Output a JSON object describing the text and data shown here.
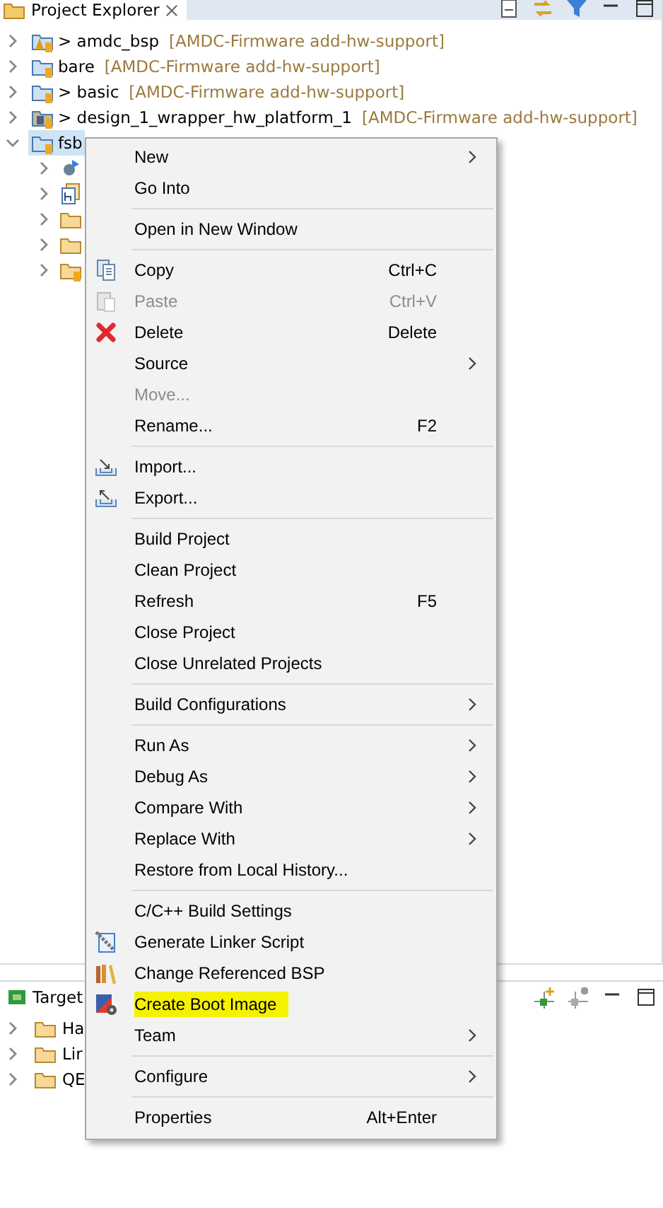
{
  "explorer": {
    "title": "Project Explorer",
    "items": [
      {
        "name": "> amdc_bsp",
        "decoration": "[AMDC-Firmware add-hw-support]",
        "kind": "bsp",
        "expanded": false,
        "selected": false
      },
      {
        "name": "bare",
        "decoration": "[AMDC-Firmware add-hw-support]",
        "kind": "project",
        "expanded": false,
        "selected": false
      },
      {
        "name": "> basic",
        "decoration": "[AMDC-Firmware add-hw-support]",
        "kind": "project",
        "expanded": false,
        "selected": false
      },
      {
        "name": "> design_1_wrapper_hw_platform_1",
        "decoration": "[AMDC-Firmware add-hw-support]",
        "kind": "hw",
        "expanded": false,
        "selected": false
      },
      {
        "name": "fsb",
        "kind": "project",
        "expanded": true,
        "selected": true,
        "children": [
          {
            "kind": "binaries",
            "expanded": false
          },
          {
            "kind": "includes",
            "expanded": false
          },
          {
            "kind": "folder",
            "expanded": false
          },
          {
            "kind": "folder",
            "expanded": false
          },
          {
            "kind": "lockfolder",
            "expanded": false
          }
        ]
      }
    ]
  },
  "target_panel": {
    "title": "Target",
    "items": [
      {
        "name": "Ha",
        "expanded": false
      },
      {
        "name": "Lir",
        "expanded": false
      },
      {
        "name": "QE",
        "expanded": false
      }
    ]
  },
  "context_menu": {
    "groups": [
      [
        {
          "label": "New",
          "submenu": true,
          "disabled": false,
          "highlighted": false
        },
        {
          "label": "Go Into",
          "submenu": false,
          "disabled": false,
          "highlighted": false
        }
      ],
      [
        {
          "label": "Open in New Window",
          "submenu": false,
          "disabled": false,
          "highlighted": false
        }
      ],
      [
        {
          "label": "Copy",
          "kind": "copy",
          "shortcut": "Ctrl+C",
          "submenu": false,
          "disabled": false,
          "highlighted": false
        },
        {
          "label": "Paste",
          "kind": "paste",
          "shortcut": "Ctrl+V",
          "submenu": false,
          "disabled": true,
          "highlighted": false
        },
        {
          "label": "Delete",
          "kind": "delete",
          "shortcut": "Delete",
          "submenu": false,
          "disabled": false,
          "highlighted": false
        },
        {
          "label": "Source",
          "submenu": true,
          "disabled": false,
          "highlighted": false
        },
        {
          "label": "Move...",
          "submenu": false,
          "disabled": true,
          "highlighted": false
        },
        {
          "label": "Rename...",
          "shortcut": "F2",
          "submenu": false,
          "disabled": false,
          "highlighted": false
        }
      ],
      [
        {
          "label": "Import...",
          "kind": "import",
          "submenu": false,
          "disabled": false,
          "highlighted": false
        },
        {
          "label": "Export...",
          "kind": "export",
          "submenu": false,
          "disabled": false,
          "highlighted": false
        }
      ],
      [
        {
          "label": "Build Project",
          "submenu": false,
          "disabled": false,
          "highlighted": false
        },
        {
          "label": "Clean Project",
          "submenu": false,
          "disabled": false,
          "highlighted": false
        },
        {
          "label": "Refresh",
          "shortcut": "F5",
          "submenu": false,
          "disabled": false,
          "highlighted": false
        },
        {
          "label": "Close Project",
          "submenu": false,
          "disabled": false,
          "highlighted": false
        },
        {
          "label": "Close Unrelated Projects",
          "submenu": false,
          "disabled": false,
          "highlighted": false
        }
      ],
      [
        {
          "label": "Build Configurations",
          "submenu": true,
          "disabled": false,
          "highlighted": false
        }
      ],
      [
        {
          "label": "Run As",
          "submenu": true,
          "disabled": false,
          "highlighted": false
        },
        {
          "label": "Debug As",
          "submenu": true,
          "disabled": false,
          "highlighted": false
        },
        {
          "label": "Compare With",
          "submenu": true,
          "disabled": false,
          "highlighted": false
        },
        {
          "label": "Replace With",
          "submenu": true,
          "disabled": false,
          "highlighted": false
        },
        {
          "label": "Restore from Local History...",
          "submenu": false,
          "disabled": false,
          "highlighted": false
        }
      ],
      [
        {
          "label": "C/C++ Build Settings",
          "submenu": false,
          "disabled": false,
          "highlighted": false
        },
        {
          "label": "Generate Linker Script",
          "kind": "linker",
          "submenu": false,
          "disabled": false,
          "highlighted": false
        },
        {
          "label": "Change Referenced BSP",
          "kind": "books",
          "submenu": false,
          "disabled": false,
          "highlighted": false
        },
        {
          "label": "Create Boot Image",
          "kind": "boot",
          "submenu": false,
          "disabled": false,
          "highlighted": true
        },
        {
          "label": "Team",
          "submenu": true,
          "disabled": false,
          "highlighted": false
        }
      ],
      [
        {
          "label": "Configure",
          "submenu": true,
          "disabled": false,
          "highlighted": false
        }
      ],
      [
        {
          "label": "Properties",
          "shortcut": "Alt+Enter",
          "submenu": false,
          "disabled": false,
          "highlighted": false
        }
      ]
    ]
  }
}
